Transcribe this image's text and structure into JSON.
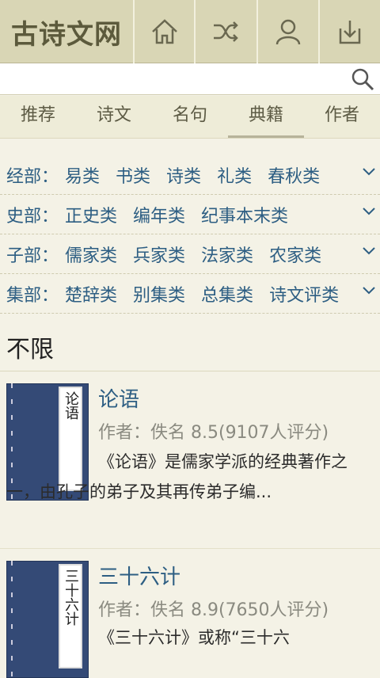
{
  "header": {
    "logo": "古诗文网",
    "buttons": [
      {
        "name": "home-icon"
      },
      {
        "name": "shuffle-icon"
      },
      {
        "name": "user-icon"
      },
      {
        "name": "download-icon"
      }
    ]
  },
  "search": {
    "placeholder": "",
    "value": ""
  },
  "tabs": [
    "推荐",
    "诗文",
    "名句",
    "典籍",
    "作者"
  ],
  "active_tab": "典籍",
  "categories": [
    {
      "name": "经部：",
      "items": [
        "易类",
        "书类",
        "诗类",
        "礼类",
        "春秋类"
      ]
    },
    {
      "name": "史部：",
      "items": [
        "正史类",
        "编年类",
        "纪事本末类"
      ]
    },
    {
      "name": "子部：",
      "items": [
        "儒家类",
        "兵家类",
        "法家类",
        "农家类"
      ]
    },
    {
      "name": "集部：",
      "items": [
        "楚辞类",
        "别集类",
        "总集类",
        "诗文评类"
      ]
    }
  ],
  "filter_label": "不限",
  "books": [
    {
      "title": "论语",
      "cover_text": "论语",
      "meta": "作者：佚名 8.5(9107人评分)",
      "desc": "《论语》是儒家学派的经典著作之一，由孔子的弟子及其再传弟子编..."
    },
    {
      "title": "三十六计",
      "cover_text": "三十六计",
      "meta": "作者：佚名 8.9(7650人评分)",
      "desc": "《三十六计》或称“三十六"
    }
  ],
  "colors": {
    "header_bg": "#d9d6b5",
    "page_bg": "#f4f2e6",
    "link": "#2d5e83",
    "cover": "#344a76"
  }
}
